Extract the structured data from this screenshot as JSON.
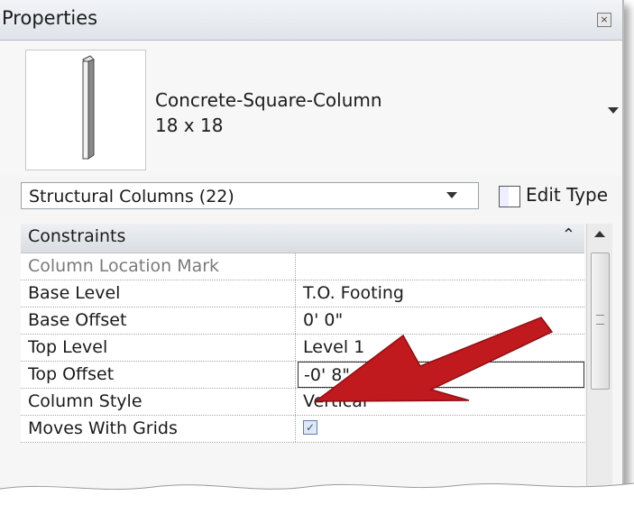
{
  "panel": {
    "title": "Properties",
    "close_icon": "close-icon"
  },
  "type_selector": {
    "family": "Concrete-Square-Column",
    "type": "18 x 18"
  },
  "filter": {
    "selected": "Structural Columns (22)",
    "edit_type_label": "Edit Type"
  },
  "grid": {
    "category": "Constraints",
    "rows": [
      {
        "name": "Column Location Mark",
        "value": ""
      },
      {
        "name": "Base Level",
        "value": "T.O. Footing"
      },
      {
        "name": "Base Offset",
        "value": "0'  0\""
      },
      {
        "name": "Top Level",
        "value": "Level 1"
      },
      {
        "name": "Top Offset",
        "value": "-0'  8\""
      },
      {
        "name": "Column Style",
        "value": "Vertical"
      },
      {
        "name": "Moves With Grids",
        "value": ""
      }
    ],
    "moves_with_grids_checked": true
  },
  "colors": {
    "annotation_arrow": "#c0191e"
  }
}
